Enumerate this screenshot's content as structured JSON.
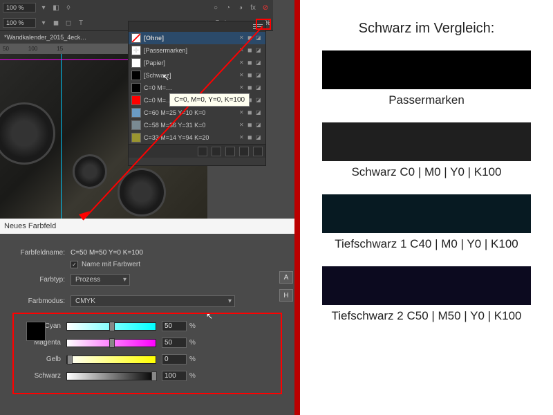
{
  "toolbar": {
    "zoom1": "100 %",
    "zoom2": "100 %",
    "farbton": "Farbton:",
    "pct": "%"
  },
  "tab": "*Wandkalender_2015_4eck…",
  "ruler": [
    "50",
    "100",
    "15"
  ],
  "swatches": {
    "items": [
      {
        "name": "[Ohne]",
        "chip": "none"
      },
      {
        "name": "[Passermarken]",
        "chip": "reg"
      },
      {
        "name": "[Papier]",
        "chip": "#fff"
      },
      {
        "name": "[Schwarz]",
        "chip": "#000"
      },
      {
        "name": "C=0 M=…",
        "chip": "#000"
      },
      {
        "name": "C=0 M=…",
        "chip": "#f00"
      },
      {
        "name": "C=60 M=25 Y=10 K=0",
        "chip": "#6a9bc4"
      },
      {
        "name": "C=58 M=36 Y=31 K=0",
        "chip": "#7a8a92"
      },
      {
        "name": "C=33 M=14 Y=94 K=20",
        "chip": "#9a9530"
      }
    ],
    "tooltip": "C=0, M=0, Y=0, K=100"
  },
  "dialog": {
    "title": "Neues Farbfeld",
    "name_label": "Farbfeldname:",
    "name_value": "C=50 M=50 Y=0 K=100",
    "name_with_value": "Name mit Farbwert",
    "type_label": "Farbtyp:",
    "type_value": "Prozess",
    "mode_label": "Farbmodus:",
    "mode_value": "CMYK",
    "btn_a": "A",
    "btn_h": "H",
    "sliders": [
      {
        "label": "Cyan",
        "value": "50",
        "pos": 50,
        "grad": "linear-gradient(to right,#fff,#0ff)"
      },
      {
        "label": "Magenta",
        "value": "50",
        "pos": 50,
        "grad": "linear-gradient(to right,#fff,#f0f)"
      },
      {
        "label": "Gelb",
        "value": "0",
        "pos": 0,
        "grad": "linear-gradient(to right,#fff,#ff0)"
      },
      {
        "label": "Schwarz",
        "value": "100",
        "pos": 100,
        "grad": "linear-gradient(to right,#fff,#000)"
      }
    ]
  },
  "comparison": {
    "title": "Schwarz im Vergleich:",
    "items": [
      {
        "label": "Passermarken",
        "color": "#000000"
      },
      {
        "label": "Schwarz C0 | M0 | Y0 | K100",
        "color": "#1f1f1f"
      },
      {
        "label": "Tiefschwarz 1 C40 | M0 | Y0 | K100",
        "color": "#071a22"
      },
      {
        "label": "Tiefschwarz 2 C50 | M50 | Y0 | K100",
        "color": "#0c0a1f"
      }
    ]
  }
}
